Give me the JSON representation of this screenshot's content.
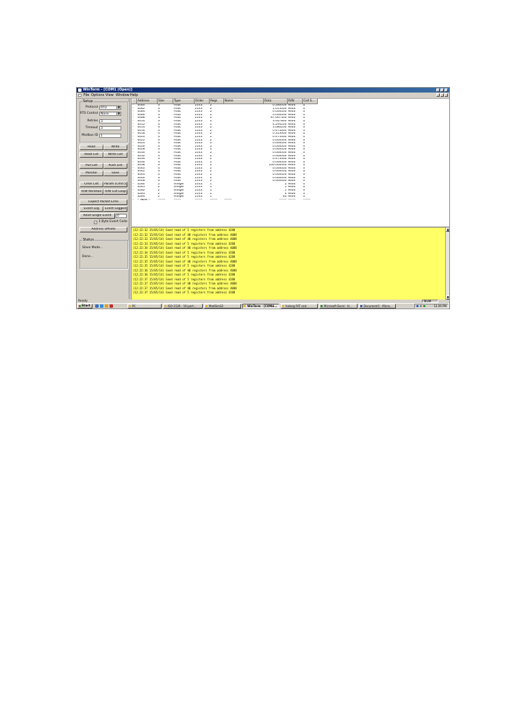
{
  "window": {
    "title": "WinTerm - [COM1 (Open)]",
    "menu": [
      "File",
      "Options",
      "View",
      "Window",
      "Help"
    ]
  },
  "setup": {
    "group_label": "Setup",
    "protocol_label": "Protocol",
    "protocol_value": "RTU",
    "rts_label": "RTS Control",
    "rts_value": "None",
    "retries_label": "Retries",
    "retries_value": "3",
    "timeout_label": "Timeout",
    "timeout_value": "3",
    "modbus_id_label": "Modbus ID",
    "modbus_id_value": "1"
  },
  "buttons": {
    "read": "Read",
    "write": "Write",
    "read_list": "Read List",
    "write_list": "Write List",
    "pull_list": "Pull List",
    "push_list": "Push List",
    "monitor": "Monitor",
    "save": "Save",
    "clear_list": "Clear List",
    "param_cmd": "Param (Cmd 5)",
    "rw_iteration": "R/W Iteration",
    "rw_list_loop": "R/W List Loop",
    "expect_packet_echo": "Expect Packet Echo",
    "event_log": "Event Log",
    "event_logged": "Event Logged",
    "read_single_event": "Read Single Event",
    "read_single_event_value": "0",
    "one_byte_event_code": "1 Byte Event Code",
    "address_offsets": "Address Offsets"
  },
  "status_group": {
    "label": "Status",
    "line1": "Slave Mode...",
    "line2": "Done..."
  },
  "table": {
    "columns": [
      "",
      "Address",
      "Size",
      "Type",
      "Order",
      "Regs",
      "Name",
      "Data",
      "R/W",
      "Coll S..."
    ],
    "rows": [
      [
        "-",
        "4080",
        "4",
        "Float",
        "2143",
        "2",
        "",
        "0.280000",
        "Read",
        "0"
      ],
      [
        "-",
        "4082",
        "4",
        "Float",
        "2143",
        "2",
        "",
        "1.015000",
        "Read",
        "0"
      ],
      [
        "-",
        "4084",
        "4",
        "Float",
        "2143",
        "2",
        "",
        "0.000000",
        "Read",
        "0"
      ],
      [
        "-",
        "4086",
        "4",
        "Float",
        "2143",
        "2",
        "",
        "0.000000",
        "Read",
        "0"
      ],
      [
        "-",
        "4088",
        "4",
        "Float",
        "2143",
        "2",
        "",
        "87.667300",
        "Read",
        "0"
      ],
      [
        "-",
        "4010",
        "4",
        "Float",
        "2143",
        "2",
        "",
        "3.447800",
        "Read",
        "0"
      ],
      [
        "-",
        "4012",
        "4",
        "Float",
        "2143",
        "2",
        "",
        "4.294100",
        "Read",
        "0"
      ],
      [
        "-",
        "4014",
        "4",
        "Float",
        "2143",
        "2",
        "",
        "3.080200",
        "Read",
        "0"
      ],
      [
        "-",
        "4016",
        "4",
        "Float",
        "2143",
        "2",
        "",
        "0.475000",
        "Read",
        "0"
      ],
      [
        "-",
        "4018",
        "4",
        "Float",
        "2143",
        "2",
        "",
        "0.355000",
        "Read",
        "0"
      ],
      [
        "-",
        "4020",
        "4",
        "Float",
        "2143",
        "2",
        "",
        "0.475000",
        "Read",
        "0"
      ],
      [
        "-",
        "4022",
        "4",
        "Float",
        "2143",
        "2",
        "",
        "0.000000",
        "Read",
        "0"
      ],
      [
        "-",
        "4024",
        "4",
        "Float",
        "2143",
        "2",
        "",
        "0.000000",
        "Read",
        "0"
      ],
      [
        "-",
        "4026",
        "4",
        "Float",
        "2143",
        "2",
        "",
        "0.000000",
        "Read",
        "0"
      ],
      [
        "-",
        "4028",
        "4",
        "Float",
        "2143",
        "2",
        "",
        "0.000000",
        "Read",
        "0"
      ],
      [
        "-",
        "4030",
        "4",
        "Float",
        "2143",
        "2",
        "",
        "0.000000",
        "Read",
        "0"
      ],
      [
        "-",
        "4032",
        "4",
        "Float",
        "2143",
        "2",
        "",
        "0.000000",
        "Read",
        "0"
      ],
      [
        "-",
        "4034",
        "4",
        "Float",
        "2143",
        "2",
        "",
        "0.475000",
        "Read",
        "0"
      ],
      [
        "-",
        "4036",
        "4",
        "Float",
        "2143",
        "2",
        "",
        "0.000000",
        "Read",
        "0"
      ],
      [
        "-",
        "4038",
        "4",
        "Float",
        "2143",
        "2",
        "",
        "100.000000",
        "Read",
        "0"
      ],
      [
        "-",
        "4040",
        "4",
        "Float",
        "2143",
        "2",
        "",
        "0.000000",
        "Read",
        "0"
      ],
      [
        "-",
        "4042",
        "4",
        "Float",
        "2143",
        "2",
        "",
        "0.000000",
        "Read",
        "0"
      ],
      [
        "-",
        "4044",
        "4",
        "Float",
        "2143",
        "2",
        "",
        "0.000000",
        "Read",
        "0"
      ],
      [
        "-",
        "4046",
        "4",
        "Float",
        "2143",
        "2",
        "",
        "0.000000",
        "Read",
        "0"
      ],
      [
        "-",
        "4048",
        "4",
        "Float",
        "2143",
        "2",
        "",
        "0.000000",
        "Read",
        "0"
      ],
      [
        "-",
        "4280",
        "2",
        "Integer",
        "2143",
        "1",
        "",
        "2",
        "Read",
        "0"
      ],
      [
        "-",
        "4281",
        "2",
        "Integer",
        "2143",
        "1",
        "",
        "1",
        "Read",
        "0"
      ],
      [
        "-",
        "4282",
        "2",
        "Integer",
        "2143",
        "1",
        "",
        "1",
        "Read",
        "0"
      ],
      [
        "-",
        "4283",
        "2",
        "Integer",
        "2143",
        "1",
        "",
        "0",
        "Read",
        "0"
      ],
      [
        "-",
        "4284",
        "2",
        "Integer",
        "2143",
        "1",
        "",
        "83",
        "Read",
        "0"
      ],
      [
        "-",
        "-- NEW --",
        "-------",
        "-------",
        "-------",
        "-------",
        "-------",
        "-------",
        "-------",
        "-------"
      ]
    ]
  },
  "log": {
    "lines": [
      "(12:22:32 15/05/14) Good read of 5 registers from address 4288",
      "(12:22:32 15/05/14) Good read of 40 registers from address 4088",
      "(12:22:33 15/05/14) Good read of 40 registers from address 4088",
      "(12:22:33 15/05/14) Good read of 5 registers from address 4288",
      "(12:22:34 15/05/14) Good read of 40 registers from address 4088",
      "(12:22:34 15/05/14) Good read of 5 registers from address 4288",
      "(12:22:35 15/05/14) Good read of 5 registers from address 4288",
      "(12:22:35 15/05/14) Good read of 40 registers from address 4088",
      "(12:22:35 15/05/14) Good read of 5 registers from address 4288",
      "(12:22:36 15/05/14) Good read of 40 registers from address 4088",
      "(12:22:36 15/05/14) Good read of 5 registers from address 4288",
      "(12:22:37 15/05/14) Good read of 5 registers from address 4288",
      "(12:22:37 15/05/14) Good read of 40 registers from address 4088",
      "(12:22:37 15/05/14) Good read of 40 registers from address 4088",
      "(12:22:37 15/05/14) Good read of 5 registers from address 4288"
    ]
  },
  "statusbar": {
    "ready": "Ready",
    "num": "NUM"
  },
  "taskbar": {
    "start": "Start",
    "tasks": [
      "PC",
      "ISO-1526 - 16-port...",
      "ModSim32",
      "WinTerm - [COM4...",
      "halang FAT calc",
      "Microsoft Excel - H...",
      "Document1 - Micro..."
    ],
    "clock": "12:26 PM"
  },
  "colors": {
    "titlebar": "#0a246a",
    "log_background": "#ffff66",
    "chrome": "#d4d0c8"
  }
}
